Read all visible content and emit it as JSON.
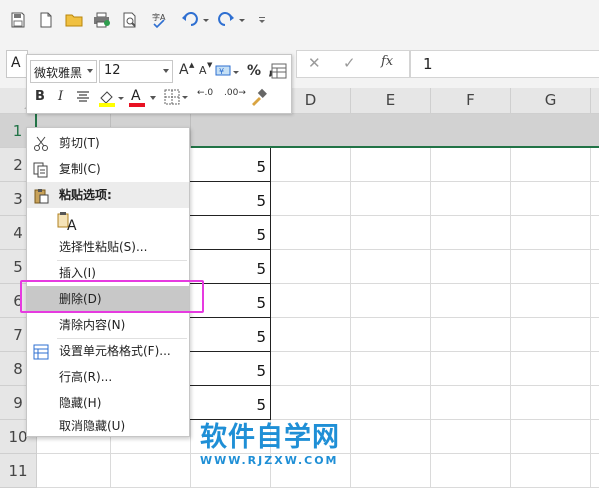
{
  "formula_bar": {
    "name_box": "A",
    "value": "1",
    "fx_label": "fx",
    "cancel_glyph": "✕",
    "enter_glyph": "✓"
  },
  "columns": [
    "D",
    "E",
    "F",
    "G"
  ],
  "rows": [
    "1",
    "2",
    "3",
    "4",
    "5",
    "6",
    "7",
    "8",
    "9",
    "10",
    "11"
  ],
  "cells": {
    "a1": "1",
    "b_values": [
      "5",
      "5",
      "5",
      "5",
      "5",
      "5",
      "5",
      "5"
    ]
  },
  "mini_toolbar": {
    "font_name": "微软雅黑",
    "font_size": "12",
    "grow_font": "A",
    "shrink_font": "A",
    "percent": "%",
    "comma": ",",
    "bold": "B",
    "italic": "I",
    "font_color_letter": "A",
    "inc_decimal": "←.0",
    "dec_decimal": ".00→"
  },
  "context_menu": {
    "items": [
      {
        "label": "剪切(T)",
        "icon": "scissors-icon"
      },
      {
        "label": "复制(C)",
        "icon": "copy-icon"
      },
      {
        "label": "粘贴选项:",
        "icon": "paste-icon"
      },
      {
        "label": "A",
        "icon": "paste-option-icon"
      },
      {
        "label": "选择性粘贴(S)..."
      },
      {
        "label": "插入(I)"
      },
      {
        "label": "删除(D)"
      },
      {
        "label": "清除内容(N)"
      },
      {
        "label": "设置单元格格式(F)...",
        "icon": "format-cells-icon"
      },
      {
        "label": "行高(R)..."
      },
      {
        "label": "隐藏(H)"
      },
      {
        "label": "取消隐藏(U)"
      }
    ]
  },
  "watermark": {
    "title": "软件自学网",
    "url": "WWW.RJZXW.COM"
  },
  "colors": {
    "accent": "#217346",
    "highlight_box": "#e63ae0",
    "watermark": "#1f8fd6",
    "font_color_bar": "#e81123",
    "fill_color_bar": "#ffff00"
  }
}
